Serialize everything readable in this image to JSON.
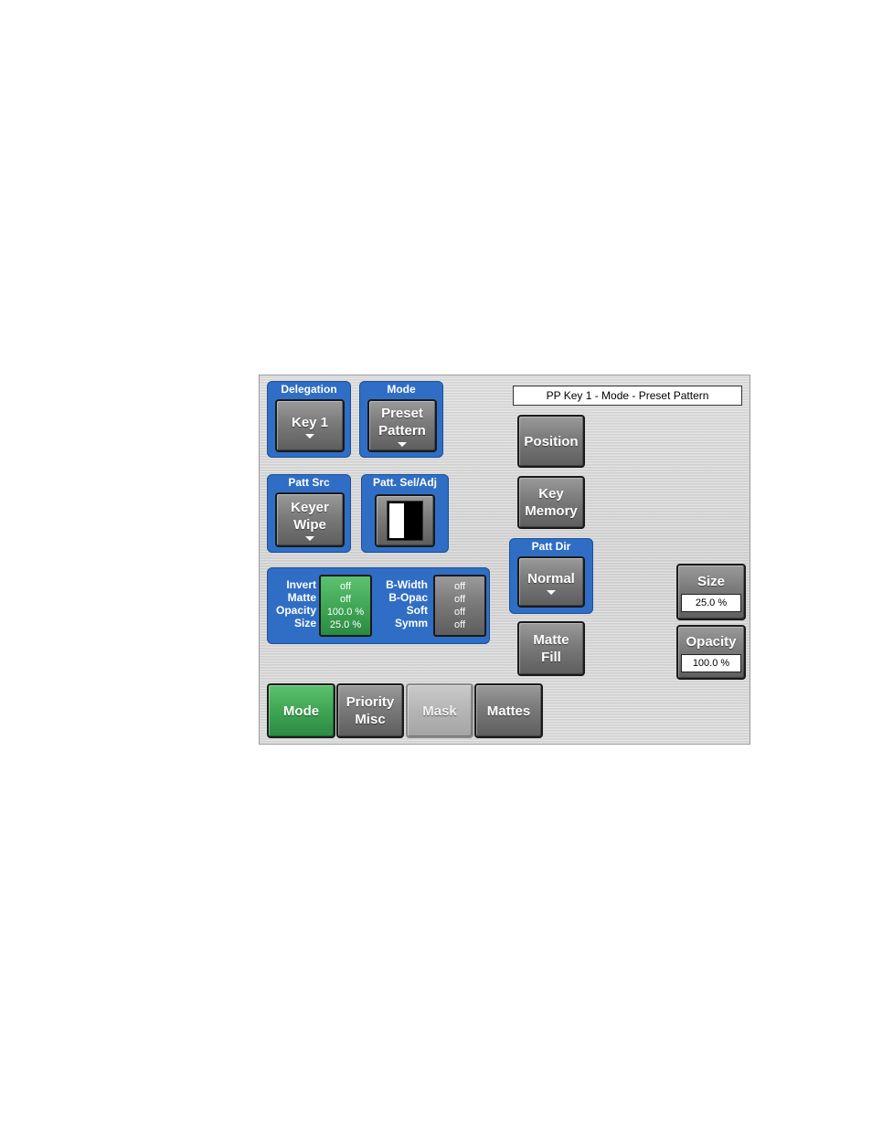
{
  "status_text": "PP Key 1 - Mode - Preset Pattern",
  "delegation": {
    "title": "Delegation",
    "label": "Key 1"
  },
  "mode": {
    "title": "Mode",
    "line1": "Preset",
    "line2": "Pattern"
  },
  "patt_src": {
    "title": "Patt Src",
    "line1": "Keyer",
    "line2": "Wipe"
  },
  "patt_sel": {
    "title": "Patt. Sel/Adj",
    "icon": "split-pattern-icon"
  },
  "patt_dir": {
    "title": "Patt Dir",
    "label": "Normal"
  },
  "params_left": {
    "labels": [
      "Invert",
      "Matte",
      "Opacity",
      "Size"
    ],
    "values": [
      "off",
      "off",
      "100.0 %",
      "25.0 %"
    ]
  },
  "params_right": {
    "labels": [
      "B-Width",
      "B-Opac",
      "Soft",
      "Symm"
    ],
    "values": [
      "off",
      "off",
      "off",
      "off"
    ]
  },
  "buttons": {
    "position": "Position",
    "key_memory_1": "Key",
    "key_memory_2": "Memory",
    "matte_fill_1": "Matte",
    "matte_fill_2": "Fill"
  },
  "size_ctrl": {
    "label": "Size",
    "value": "25.0 %"
  },
  "opacity_ctrl": {
    "label": "Opacity",
    "value": "100.0 %"
  },
  "tabs": {
    "mode": "Mode",
    "priority_1": "Priority",
    "priority_2": "Misc",
    "mask": "Mask",
    "mattes": "Mattes"
  },
  "colors": {
    "group_blue": "#2f6ec4",
    "active_green": "#3fa555"
  }
}
